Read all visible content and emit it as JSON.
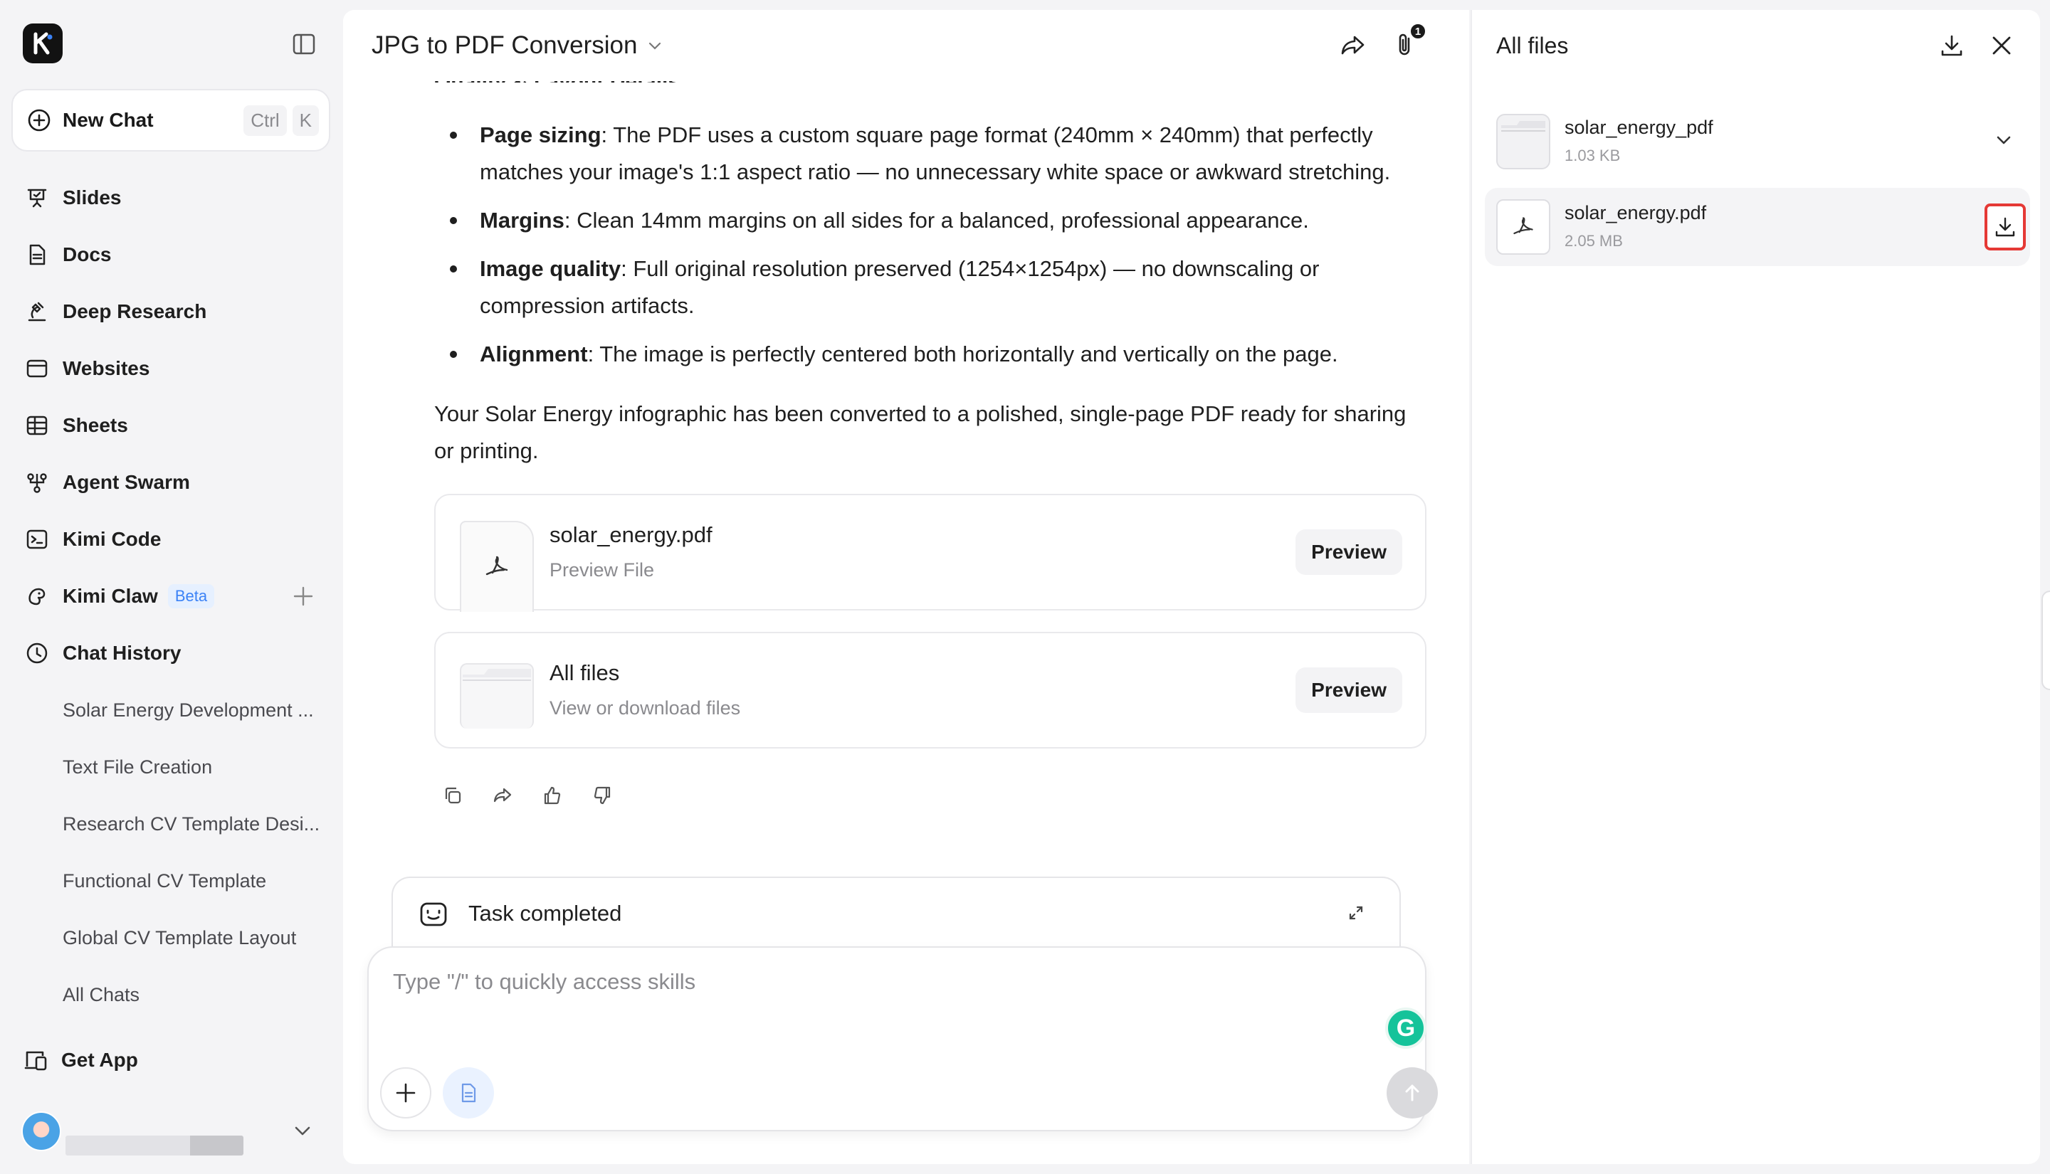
{
  "sidebar": {
    "new_chat": {
      "label": "New Chat",
      "shortcut": [
        "Ctrl",
        "K"
      ]
    },
    "nav": [
      {
        "label": "Slides",
        "icon": "slides-icon"
      },
      {
        "label": "Docs",
        "icon": "docs-icon"
      },
      {
        "label": "Deep Research",
        "icon": "deep-research-icon"
      },
      {
        "label": "Websites",
        "icon": "websites-icon"
      },
      {
        "label": "Sheets",
        "icon": "sheets-icon"
      },
      {
        "label": "Agent Swarm",
        "icon": "agent-swarm-icon"
      },
      {
        "label": "Kimi Code",
        "icon": "terminal-icon"
      },
      {
        "label": "Kimi Claw",
        "icon": "claw-icon",
        "badge": "Beta"
      },
      {
        "label": "Chat History",
        "icon": "clock-icon"
      }
    ],
    "history": [
      "Solar Energy Development ...",
      "Text File Creation",
      "Research CV Template Desi...",
      "Functional CV Template",
      "Global CV Template Layout",
      "All Chats"
    ],
    "get_app": "Get App"
  },
  "main": {
    "title": "JPG to PDF Conversion",
    "attachment_count": "1",
    "partial_heading": "Quality & Layout Details",
    "bullets": [
      {
        "term": "Page sizing",
        "text": ": The PDF uses a custom square page format (240mm × 240mm) that perfectly matches your image's 1:1 aspect ratio — no unnecessary white space or awkward stretching."
      },
      {
        "term": "Margins",
        "text": ": Clean 14mm margins on all sides for a balanced, professional appearance."
      },
      {
        "term": "Image quality",
        "text": ": Full original resolution preserved (1254×1254px) — no downscaling or compression artifacts."
      },
      {
        "term": "Alignment",
        "text": ": The image is perfectly centered both horizontally and vertically on the page."
      }
    ],
    "summary": "Your Solar Energy infographic has been converted to a polished, single-page PDF ready for sharing or printing.",
    "cards": [
      {
        "name": "solar_energy.pdf",
        "sub": "Preview File",
        "button": "Preview"
      },
      {
        "name": "All files",
        "sub": "View or download files",
        "button": "Preview"
      }
    ],
    "task_status": "Task completed",
    "input_placeholder": "Type \"/\" to quickly access skills"
  },
  "files_panel": {
    "title": "All files",
    "items": [
      {
        "name": "solar_energy_pdf",
        "size": "1.03 KB",
        "kind": "folder"
      },
      {
        "name": "solar_energy.pdf",
        "size": "2.05 MB",
        "kind": "pdf"
      }
    ]
  },
  "colors": {
    "accent_blue": "#3b82f6",
    "highlight_red": "#e53935",
    "grammarly_green": "#15c39a"
  }
}
